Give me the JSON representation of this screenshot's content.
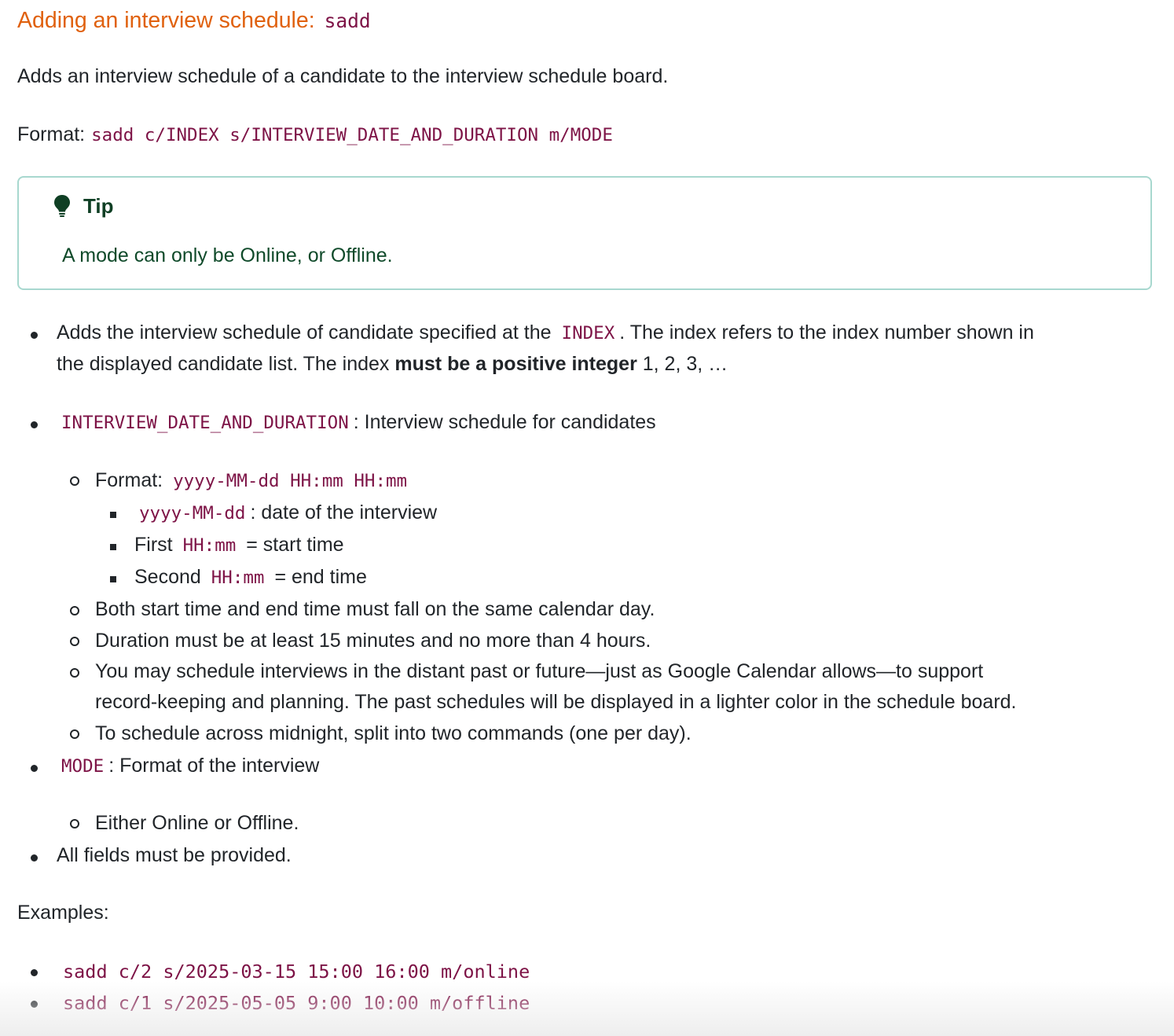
{
  "heading": {
    "text": "Adding an interview schedule:",
    "command": "sadd"
  },
  "intro": "Adds an interview schedule of a candidate to the interview schedule board.",
  "format": {
    "label": "Format:",
    "value": "sadd c/INDEX s/INTERVIEW_DATE_AND_DURATION m/MODE"
  },
  "tip": {
    "title": "Tip",
    "body": "A mode can only be Online, or Offline."
  },
  "bullets": {
    "index": {
      "pre": "Adds the interview schedule of candidate specified at the",
      "code": "INDEX",
      "post": ". The index refers to the index number shown in",
      "line2_pre": "the displayed candidate list. The index",
      "line2_bold": "must be a positive integer",
      "line2_post": "1, 2, 3, …"
    },
    "datetime": {
      "code": "INTERVIEW_DATE_AND_DURATION",
      "text": ": Interview schedule for candidates",
      "format_label": "Format:",
      "format_code": "yyyy-MM-dd HH:mm HH:mm",
      "sub": [
        {
          "pre": "",
          "code": "yyyy-MM-dd",
          "post": ": date of the interview"
        },
        {
          "pre": "First",
          "code": "HH:mm",
          "post": "= start time"
        },
        {
          "pre": "Second",
          "code": "HH:mm",
          "post": "= end time"
        }
      ],
      "rule1": "Both start time and end time must fall on the same calendar day.",
      "rule2": "Duration must be at least 15 minutes and no more than 4 hours.",
      "rule3_line1": "You may schedule interviews in the distant past or future—just as Google Calendar allows—to support",
      "rule3_line2": "record-keeping and planning. The past schedules will be displayed in a lighter color in the schedule board.",
      "rule4": "To schedule across midnight, split into two commands (one per day)."
    },
    "mode": {
      "code": "MODE",
      "text": ": Format of the interview",
      "sub": "Either Online or Offline."
    },
    "all_fields": "All fields must be provided."
  },
  "examples": {
    "label": "Examples:",
    "items": [
      "sadd c/2 s/2025-03-15 15:00 16:00 m/online",
      "sadd c/1 s/2025-05-05 9:00 10:00 m/offline"
    ]
  },
  "colors": {
    "heading": "#e0610e",
    "code": "#7d1346",
    "tip_border": "#a8d8cf",
    "tip_text": "#0f4a2a"
  }
}
